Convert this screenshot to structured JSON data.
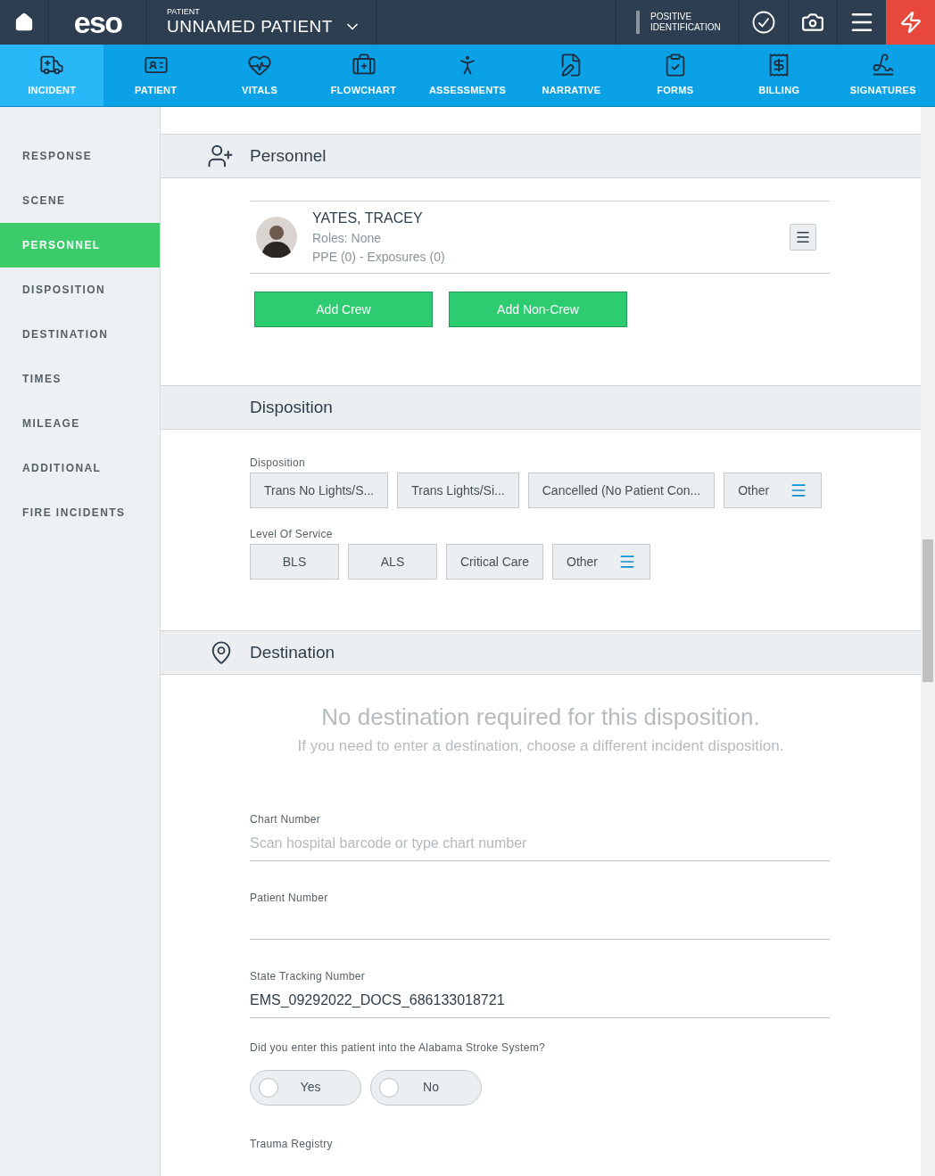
{
  "top_bar": {
    "logo": "eso",
    "patient_label": "PATIENT",
    "patient_name": "UNNAMED PATIENT",
    "positive_identification": "POSITIVE IDENTIFICATION"
  },
  "nav_tabs": [
    {
      "label": "INCIDENT",
      "selected": true
    },
    {
      "label": "PATIENT",
      "selected": false
    },
    {
      "label": "VITALS",
      "selected": false
    },
    {
      "label": "FLOWCHART",
      "selected": false
    },
    {
      "label": "ASSESSMENTS",
      "selected": false
    },
    {
      "label": "NARRATIVE",
      "selected": false
    },
    {
      "label": "FORMS",
      "selected": false
    },
    {
      "label": "BILLING",
      "selected": false
    },
    {
      "label": "SIGNATURES",
      "selected": false
    }
  ],
  "sidebar": {
    "items": [
      {
        "label": "RESPONSE",
        "selected": false
      },
      {
        "label": "SCENE",
        "selected": false
      },
      {
        "label": "PERSONNEL",
        "selected": true
      },
      {
        "label": "DISPOSITION",
        "selected": false
      },
      {
        "label": "DESTINATION",
        "selected": false
      },
      {
        "label": "TIMES",
        "selected": false
      },
      {
        "label": "MILEAGE",
        "selected": false
      },
      {
        "label": "ADDITIONAL",
        "selected": false
      },
      {
        "label": "FIRE INCIDENTS",
        "selected": false
      }
    ]
  },
  "personnel": {
    "title": "Personnel",
    "crew": [
      {
        "name": "YATES, TRACEY",
        "roles": "Roles: None",
        "ppe": "PPE (0) - Exposures (0)"
      }
    ],
    "buttons": [
      "Add Crew",
      "Add Non-Crew"
    ]
  },
  "disposition": {
    "title": "Disposition",
    "groups": [
      {
        "label": "Disposition",
        "options": [
          {
            "label": "Trans No Lights/S...",
            "kind": "option",
            "selected": false
          },
          {
            "label": "Trans Lights/Si...",
            "kind": "option",
            "selected": false
          },
          {
            "label": "Cancelled (No Patient Con...",
            "kind": "option",
            "selected": false
          },
          {
            "label": "Other",
            "kind": "menu",
            "selected": false
          }
        ]
      },
      {
        "label": "Level Of Service",
        "options": [
          {
            "label": "BLS",
            "kind": "option",
            "selected": false
          },
          {
            "label": "ALS",
            "kind": "option",
            "selected": false
          },
          {
            "label": "Critical Care",
            "kind": "option",
            "selected": false
          },
          {
            "label": "Other",
            "kind": "menu",
            "selected": false
          }
        ]
      }
    ]
  },
  "destination": {
    "title": "Destination",
    "notice_title": "No destination required for this disposition.",
    "notice_text": "If you need to enter a destination, choose a different incident disposition.",
    "fields": [
      {
        "label": "Chart Number",
        "placeholder": "Scan hospital barcode or type chart number"
      },
      {
        "label": "Patient Number"
      },
      {
        "label": "State Tracking Number",
        "value": "EMS_09292022_DOCS_686133018721"
      }
    ],
    "question": {
      "label": "Did you enter this patient into the Alabama Stroke System?",
      "options": [
        {
          "label": "Yes",
          "selected": false
        },
        {
          "label": "No",
          "selected": false
        }
      ]
    },
    "trauma_registry": {
      "label": "Trauma Registry"
    }
  }
}
